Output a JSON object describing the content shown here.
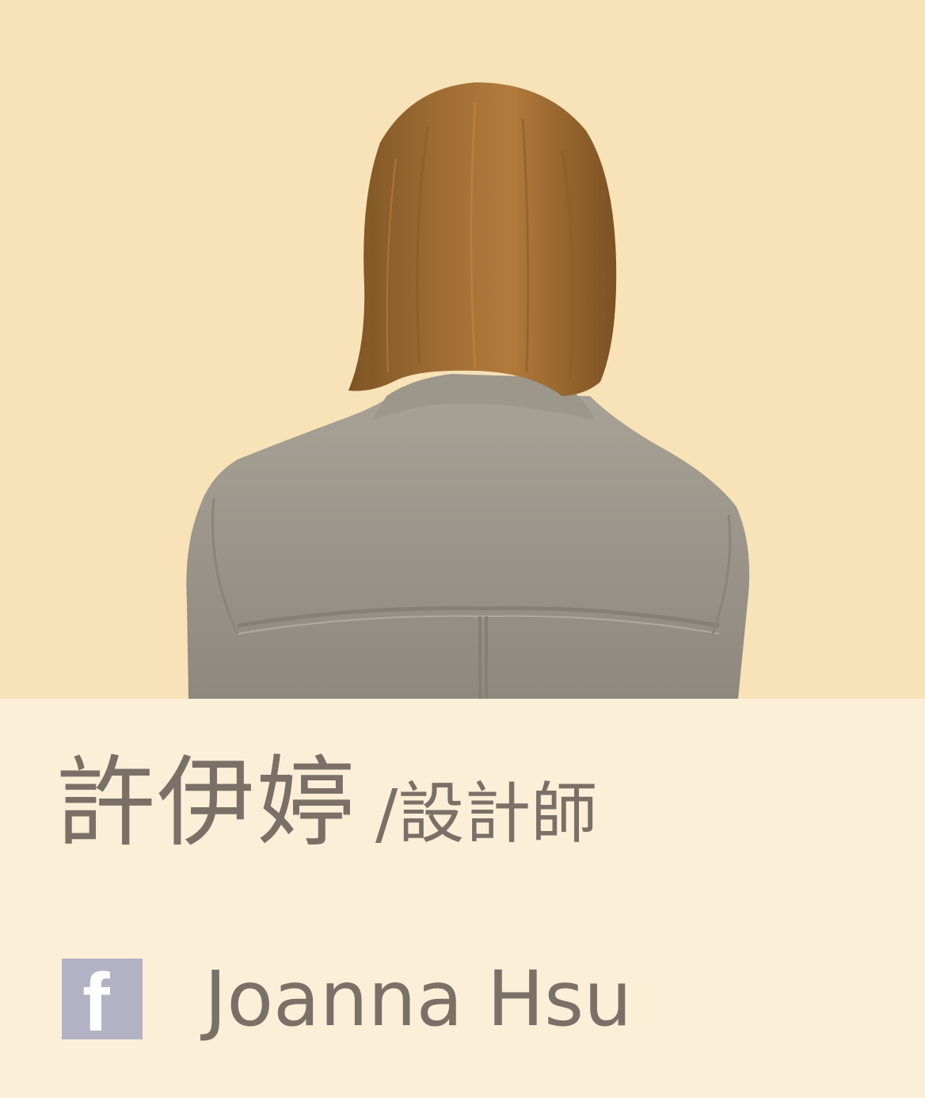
{
  "profile": {
    "name": "許伊婷",
    "role": "/設計師",
    "facebook_icon": "facebook-icon",
    "facebook_glyph": "f",
    "facebook_handle": "Joanna Hsu"
  },
  "colors": {
    "photo_background": "#f8e2b7",
    "info_background": "#fcefd8",
    "text": "#7a7068",
    "facebook_icon_bg": "#b3b1c4",
    "hair": "#9a6a33",
    "jacket": "#9a958a"
  }
}
